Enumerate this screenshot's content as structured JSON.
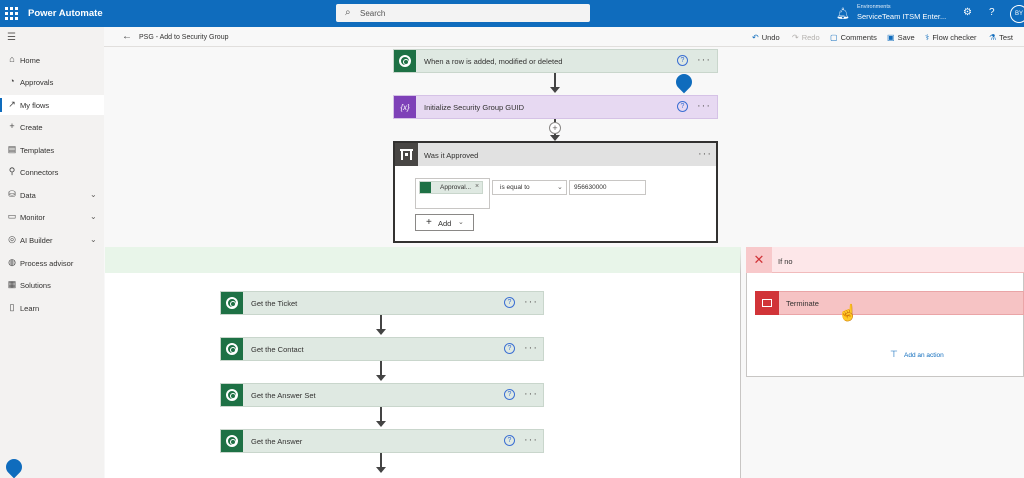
{
  "header": {
    "app_title": "Power Automate",
    "search_placeholder": "Search",
    "env_label": "Environments",
    "env_name": "ServiceTeam ITSM Enter...",
    "avatar_initials": "BY"
  },
  "sidebar": {
    "items": [
      {
        "label": "Home",
        "icon": "home-icon"
      },
      {
        "label": "Approvals",
        "icon": "approvals-icon"
      },
      {
        "label": "My flows",
        "icon": "flows-icon"
      },
      {
        "label": "Create",
        "icon": "plus-icon"
      },
      {
        "label": "Templates",
        "icon": "templates-icon"
      },
      {
        "label": "Connectors",
        "icon": "connectors-icon"
      },
      {
        "label": "Data",
        "icon": "data-icon"
      },
      {
        "label": "Monitor",
        "icon": "monitor-icon"
      },
      {
        "label": "AI Builder",
        "icon": "ai-builder-icon"
      },
      {
        "label": "Process advisor",
        "icon": "process-advisor-icon"
      },
      {
        "label": "Solutions",
        "icon": "solutions-icon"
      },
      {
        "label": "Learn",
        "icon": "learn-icon"
      }
    ],
    "active": "My flows"
  },
  "commandbar": {
    "flow_title": "PSG - Add to Security Group",
    "undo": "Undo",
    "redo": "Redo",
    "comments": "Comments",
    "save": "Save",
    "flow_checker": "Flow checker",
    "test": "Test"
  },
  "flow": {
    "trigger": "When a row is added, modified or deleted",
    "init_var": "Initialize Security Group GUID",
    "init_var_icon_text": "{x}",
    "condition": {
      "title": "Was it Approved",
      "token": "Approval...",
      "operator": "is equal to",
      "value": "956630000",
      "add_label": "Add"
    },
    "yes_actions": [
      "Get the Ticket",
      "Get the Contact",
      "Get the Answer Set",
      "Get the Answer"
    ],
    "no_branch": {
      "title": "If no",
      "action": "Terminate",
      "add_action": "Add an action"
    }
  },
  "colors": {
    "brand": "#0f6cbd",
    "dataverse_green": "#1e7145",
    "variable_purple": "#7e41b8",
    "terminate_red": "#d13438"
  }
}
